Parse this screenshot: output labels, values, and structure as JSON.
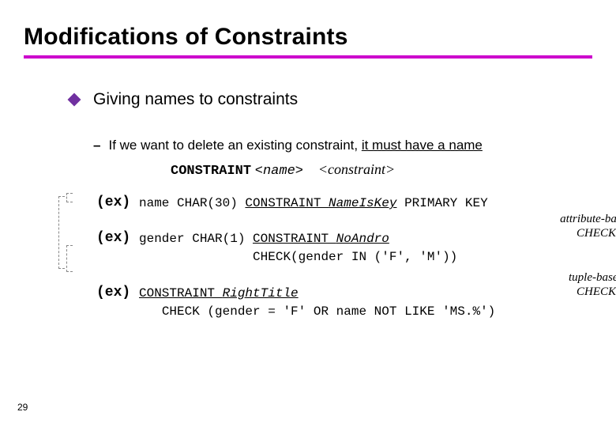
{
  "title": "Modifications of Constraints",
  "level1": {
    "text": "Giving names to constraints"
  },
  "level2": {
    "prefix": "If we want to delete an existing constraint, ",
    "emph": "it must have a name"
  },
  "syntax": {
    "kw": "CONSTRAINT",
    "name": "<name>",
    "constraint": "<constraint>"
  },
  "examples": {
    "label": "(ex)",
    "ex1": {
      "pre": "name CHAR(30) ",
      "kw_u": "CONSTRAINT ",
      "cname": "NameIsKey",
      "post": " PRIMARY KEY"
    },
    "ex2": {
      "pre": "gender CHAR(1) ",
      "kw_u": "CONSTRAINT ",
      "cname": "NoAndro",
      "line2": "CHECK(gender IN ('F', 'M'))"
    },
    "ex3": {
      "kw_u": "CONSTRAINT ",
      "cname": "RightTitle",
      "line2": "CHECK (gender = 'F' OR name NOT LIKE 'MS.%')"
    }
  },
  "annotations": {
    "attr": "attribute-based CHECK",
    "tuple": "tuple-based CHECK"
  },
  "page": "29"
}
